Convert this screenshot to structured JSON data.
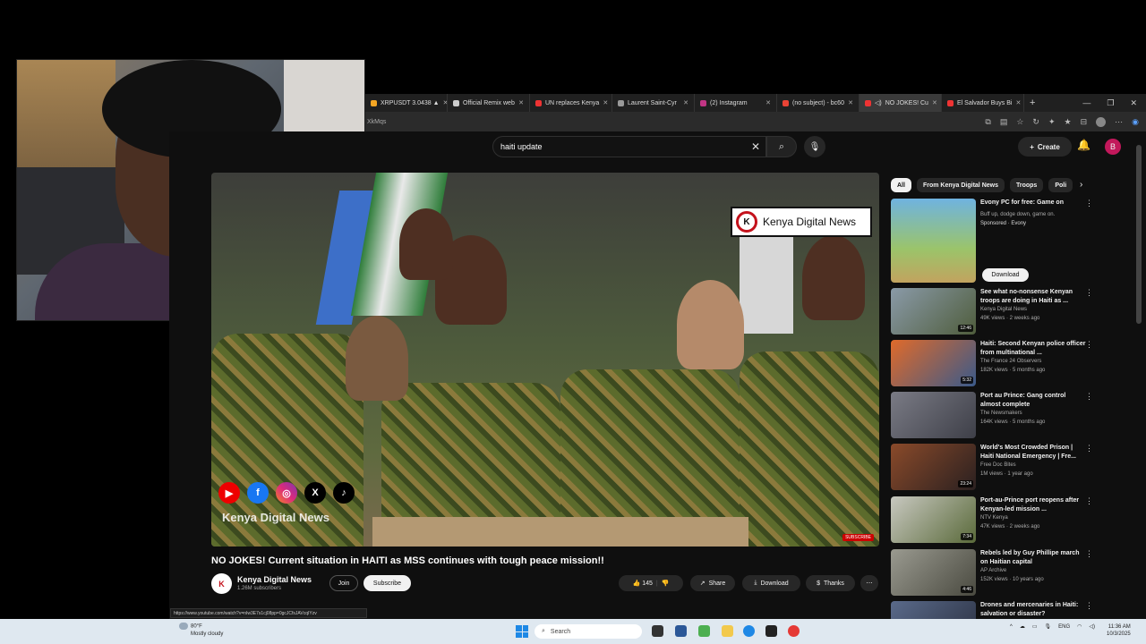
{
  "browser": {
    "tabs": [
      {
        "label": "XRPUSDT 3.0438 ▲",
        "active": false
      },
      {
        "label": "Official Remix web",
        "active": false
      },
      {
        "label": "UN replaces Kenya",
        "active": false
      },
      {
        "label": "Laurent Saint-Cyr",
        "active": false
      },
      {
        "label": "(2) Instagram",
        "active": false
      },
      {
        "label": "(no subject) - bc60",
        "active": false
      },
      {
        "label": "NO JOKES! Cu",
        "active": true
      },
      {
        "label": "El Salvador Buys Bi",
        "active": false
      }
    ],
    "url_fragment": "XkMqs"
  },
  "youtube": {
    "search_value": "haiti update",
    "create_label": "Create",
    "avatar_letter": "B",
    "video": {
      "title": "NO JOKES! Current situation in HAITI as MSS continues with tough peace mission!!",
      "overlay_logo": "Kenya Digital News",
      "watermark": "Kenya Digital News",
      "subscribe_badge": "SUBSCRIBE"
    },
    "channel": {
      "name": "Kenya Digital News",
      "subs": "1.26M subscribers",
      "join_label": "Join",
      "subscribe_label": "Subscribe"
    },
    "actions": {
      "likes": "145",
      "share": "Share",
      "download": "Download",
      "thanks": "Thanks"
    },
    "status_url": "https://www.youtube.com/watch?v=nIw3E7s1cj08pp=0gcJCfsJAVcqIYzv",
    "chips": [
      "All",
      "From Kenya Digital News",
      "Troops",
      "Poli"
    ],
    "recommendations": [
      {
        "title": "Evony PC for free: Game on",
        "channel": "Buff up, dodge down, game on.",
        "meta": "Sponsored · Evony",
        "duration": "",
        "button": "Download"
      },
      {
        "title": "See what no-nonsense Kenyan troops are doing in Haiti as ...",
        "channel": "Kenya Digital News",
        "meta": "49K views · 2 weeks ago",
        "duration": "12:46"
      },
      {
        "title": "Haiti: Second Kenyan police officer from multinational ...",
        "channel": "The France 24 Observers",
        "meta": "182K views · 5 months ago",
        "duration": "5:32"
      },
      {
        "title": "Port au Prince: Gang control almost complete",
        "channel": "The Newsmakers",
        "meta": "164K views · 5 months ago",
        "duration": ""
      },
      {
        "title": "World's Most Crowded Prison | Haiti National Emergency | Fre...",
        "channel": "Free Doc Bites",
        "meta": "1M views · 1 year ago",
        "duration": "23:24"
      },
      {
        "title": "Port-au-Prince port reopens after Kenyan-led mission ...",
        "channel": "NTV Kenya",
        "meta": "47K views · 2 weeks ago",
        "duration": "7:34"
      },
      {
        "title": "Rebels led by Guy Phillipe march on Haitian capital",
        "channel": "AP Archive",
        "meta": "152K views · 10 years ago",
        "duration": "4:46"
      },
      {
        "title": "Drones and mercenaries in Haiti: salvation or disaster?",
        "channel": "",
        "meta": "",
        "duration": ""
      }
    ]
  },
  "taskbar": {
    "weather_temp": "80°F",
    "weather_desc": "Mostly cloudy",
    "search_placeholder": "Search",
    "lang": "ENG",
    "time": "11:36 AM",
    "date": "10/3/2025"
  }
}
